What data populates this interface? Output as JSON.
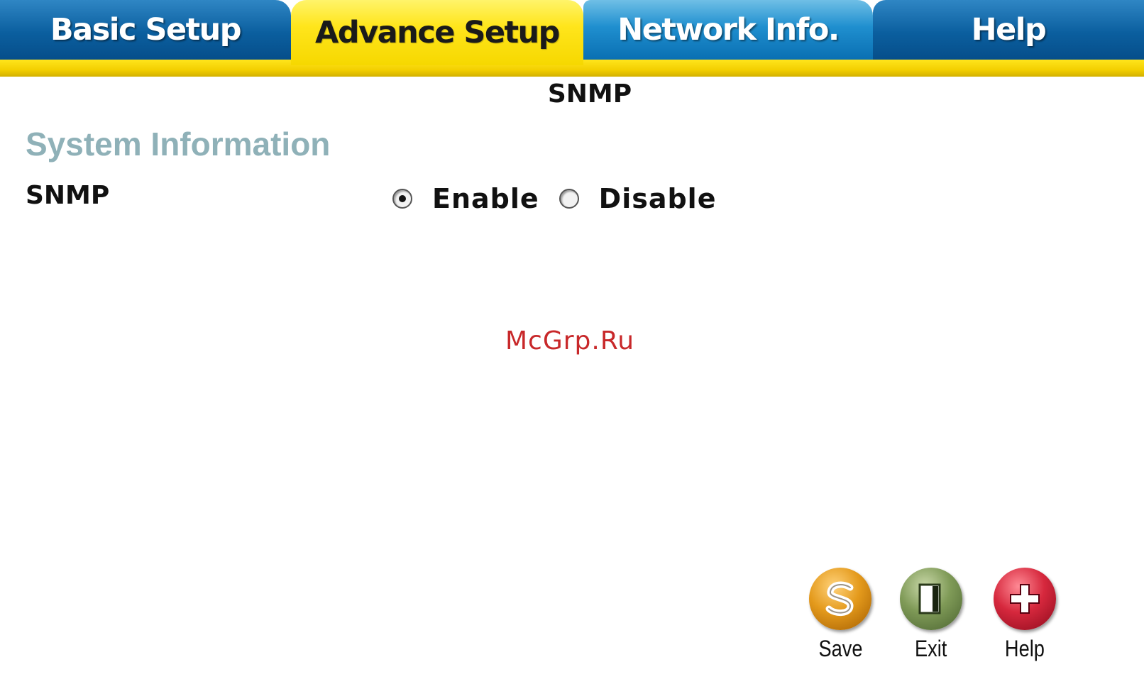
{
  "tabs": [
    {
      "label": "Basic Setup",
      "active": false
    },
    {
      "label": "Advance Setup",
      "active": true
    },
    {
      "label": "Network Info.",
      "active": false
    },
    {
      "label": "Help",
      "active": false
    }
  ],
  "page": {
    "title": "SNMP",
    "section_title": "System Information"
  },
  "snmp": {
    "label": "SNMP",
    "options": [
      {
        "label": "Enable",
        "checked": true
      },
      {
        "label": "Disable",
        "checked": false
      }
    ]
  },
  "watermark": "McGrp.Ru",
  "actions": [
    {
      "label": "Save",
      "icon": "save-icon"
    },
    {
      "label": "Exit",
      "icon": "exit-icon"
    },
    {
      "label": "Help",
      "icon": "help-plus-icon"
    }
  ],
  "colors": {
    "tab_blue": "#0b5f9f",
    "tab_active_yellow": "#ffe51c",
    "section_title": "#8fb1b8",
    "watermark": "#c8282a"
  }
}
